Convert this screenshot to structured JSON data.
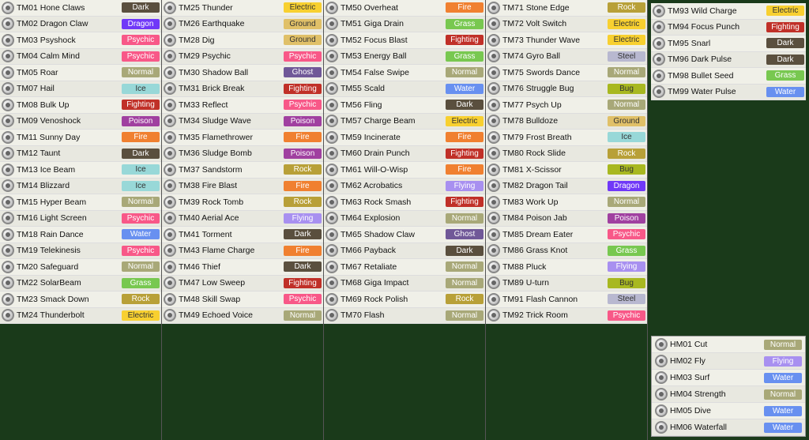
{
  "columns": [
    [
      {
        "id": "TM01",
        "name": "Hone Claws",
        "type": "Dark"
      },
      {
        "id": "TM02",
        "name": "Dragon Claw",
        "type": "Dragon"
      },
      {
        "id": "TM03",
        "name": "Psyshock",
        "type": "Psychic"
      },
      {
        "id": "TM04",
        "name": "Calm Mind",
        "type": "Psychic"
      },
      {
        "id": "TM05",
        "name": "Roar",
        "type": "Normal"
      },
      {
        "id": "TM07",
        "name": "Hail",
        "type": "Ice"
      },
      {
        "id": "TM08",
        "name": "Bulk Up",
        "type": "Fighting"
      },
      {
        "id": "TM09",
        "name": "Venoshock",
        "type": "Poison"
      },
      {
        "id": "TM11",
        "name": "Sunny Day",
        "type": "Fire"
      },
      {
        "id": "TM12",
        "name": "Taunt",
        "type": "Dark"
      },
      {
        "id": "TM13",
        "name": "Ice Beam",
        "type": "Ice"
      },
      {
        "id": "TM14",
        "name": "Blizzard",
        "type": "Ice"
      },
      {
        "id": "TM15",
        "name": "Hyper Beam",
        "type": "Normal"
      },
      {
        "id": "TM16",
        "name": "Light Screen",
        "type": "Psychic"
      },
      {
        "id": "TM18",
        "name": "Rain Dance",
        "type": "Water"
      },
      {
        "id": "TM19",
        "name": "Telekinesis",
        "type": "Psychic"
      },
      {
        "id": "TM20",
        "name": "Safeguard",
        "type": "Normal"
      },
      {
        "id": "TM22",
        "name": "SolarBeam",
        "type": "Grass"
      },
      {
        "id": "TM23",
        "name": "Smack Down",
        "type": "Rock"
      },
      {
        "id": "TM24",
        "name": "Thunderbolt",
        "type": "Electric"
      }
    ],
    [
      {
        "id": "TM25",
        "name": "Thunder",
        "type": "Electric"
      },
      {
        "id": "TM26",
        "name": "Earthquake",
        "type": "Ground"
      },
      {
        "id": "TM28",
        "name": "Dig",
        "type": "Ground"
      },
      {
        "id": "TM29",
        "name": "Psychic",
        "type": "Psychic"
      },
      {
        "id": "TM30",
        "name": "Shadow Ball",
        "type": "Ghost"
      },
      {
        "id": "TM31",
        "name": "Brick Break",
        "type": "Fighting"
      },
      {
        "id": "TM33",
        "name": "Reflect",
        "type": "Psychic"
      },
      {
        "id": "TM34",
        "name": "Sludge Wave",
        "type": "Poison"
      },
      {
        "id": "TM35",
        "name": "Flamethrower",
        "type": "Fire"
      },
      {
        "id": "TM36",
        "name": "Sludge Bomb",
        "type": "Poison"
      },
      {
        "id": "TM37",
        "name": "Sandstorm",
        "type": "Rock"
      },
      {
        "id": "TM38",
        "name": "Fire Blast",
        "type": "Fire"
      },
      {
        "id": "TM39",
        "name": "Rock Tomb",
        "type": "Rock"
      },
      {
        "id": "TM40",
        "name": "Aerial Ace",
        "type": "Flying"
      },
      {
        "id": "TM41",
        "name": "Torment",
        "type": "Dark"
      },
      {
        "id": "TM43",
        "name": "Flame Charge",
        "type": "Fire"
      },
      {
        "id": "TM46",
        "name": "Thief",
        "type": "Dark"
      },
      {
        "id": "TM47",
        "name": "Low Sweep",
        "type": "Fighting"
      },
      {
        "id": "TM48",
        "name": "Skill Swap",
        "type": "Psychic"
      },
      {
        "id": "TM49",
        "name": "Echoed Voice",
        "type": "Normal"
      }
    ],
    [
      {
        "id": "TM50",
        "name": "Overheat",
        "type": "Fire"
      },
      {
        "id": "TM51",
        "name": "Giga Drain",
        "type": "Grass"
      },
      {
        "id": "TM52",
        "name": "Focus Blast",
        "type": "Fighting"
      },
      {
        "id": "TM53",
        "name": "Energy Ball",
        "type": "Grass"
      },
      {
        "id": "TM54",
        "name": "False Swipe",
        "type": "Normal"
      },
      {
        "id": "TM55",
        "name": "Scald",
        "type": "Water"
      },
      {
        "id": "TM56",
        "name": "Fling",
        "type": "Dark"
      },
      {
        "id": "TM57",
        "name": "Charge Beam",
        "type": "Electric"
      },
      {
        "id": "TM59",
        "name": "Incinerate",
        "type": "Fire"
      },
      {
        "id": "TM60",
        "name": "Drain Punch",
        "type": "Fighting"
      },
      {
        "id": "TM61",
        "name": "Will-O-Wisp",
        "type": "Fire"
      },
      {
        "id": "TM62",
        "name": "Acrobatics",
        "type": "Flying"
      },
      {
        "id": "TM63",
        "name": "Rock Smash",
        "type": "Fighting"
      },
      {
        "id": "TM64",
        "name": "Explosion",
        "type": "Normal"
      },
      {
        "id": "TM65",
        "name": "Shadow Claw",
        "type": "Ghost"
      },
      {
        "id": "TM66",
        "name": "Payback",
        "type": "Dark"
      },
      {
        "id": "TM67",
        "name": "Retaliate",
        "type": "Normal"
      },
      {
        "id": "TM68",
        "name": "Giga Impact",
        "type": "Normal"
      },
      {
        "id": "TM69",
        "name": "Rock Polish",
        "type": "Rock"
      },
      {
        "id": "TM70",
        "name": "Flash",
        "type": "Normal"
      }
    ],
    [
      {
        "id": "TM71",
        "name": "Stone Edge",
        "type": "Rock"
      },
      {
        "id": "TM72",
        "name": "Volt Switch",
        "type": "Electric"
      },
      {
        "id": "TM73",
        "name": "Thunder Wave",
        "type": "Electric"
      },
      {
        "id": "TM74",
        "name": "Gyro Ball",
        "type": "Steel"
      },
      {
        "id": "TM75",
        "name": "Swords Dance",
        "type": "Normal"
      },
      {
        "id": "TM76",
        "name": "Struggle Bug",
        "type": "Bug"
      },
      {
        "id": "TM77",
        "name": "Psych Up",
        "type": "Normal"
      },
      {
        "id": "TM78",
        "name": "Bulldoze",
        "type": "Ground"
      },
      {
        "id": "TM79",
        "name": "Frost Breath",
        "type": "Ice"
      },
      {
        "id": "TM80",
        "name": "Rock Slide",
        "type": "Rock"
      },
      {
        "id": "TM81",
        "name": "X-Scissor",
        "type": "Bug"
      },
      {
        "id": "TM82",
        "name": "Dragon Tail",
        "type": "Dragon"
      },
      {
        "id": "TM83",
        "name": "Work Up",
        "type": "Normal"
      },
      {
        "id": "TM84",
        "name": "Poison Jab",
        "type": "Poison"
      },
      {
        "id": "TM85",
        "name": "Dream Eater",
        "type": "Psychic"
      },
      {
        "id": "TM86",
        "name": "Grass Knot",
        "type": "Grass"
      },
      {
        "id": "TM88",
        "name": "Pluck",
        "type": "Flying"
      },
      {
        "id": "TM89",
        "name": "U-turn",
        "type": "Bug"
      },
      {
        "id": "TM91",
        "name": "Flash Cannon",
        "type": "Steel"
      },
      {
        "id": "TM92",
        "name": "Trick Room",
        "type": "Psychic"
      }
    ],
    [
      {
        "id": "TM93",
        "name": "Wild Charge",
        "type": "Electric"
      },
      {
        "id": "TM94",
        "name": "Focus Punch",
        "type": "Fighting"
      },
      {
        "id": "TM95",
        "name": "Snarl",
        "type": "Dark"
      },
      {
        "id": "TM96",
        "name": "Dark Pulse",
        "type": "Dark"
      },
      {
        "id": "TM98",
        "name": "Bullet Seed",
        "type": "Grass"
      },
      {
        "id": "TM99",
        "name": "Water Pulse",
        "type": "Water"
      }
    ]
  ],
  "hms": [
    {
      "id": "HM01",
      "name": "Cut",
      "type": "Normal"
    },
    {
      "id": "HM02",
      "name": "Fly",
      "type": "Flying"
    },
    {
      "id": "HM03",
      "name": "Surf",
      "type": "Water"
    },
    {
      "id": "HM04",
      "name": "Strength",
      "type": "Normal"
    },
    {
      "id": "HM05",
      "name": "Dive",
      "type": "Water"
    },
    {
      "id": "HM06",
      "name": "Waterfall",
      "type": "Water"
    }
  ]
}
